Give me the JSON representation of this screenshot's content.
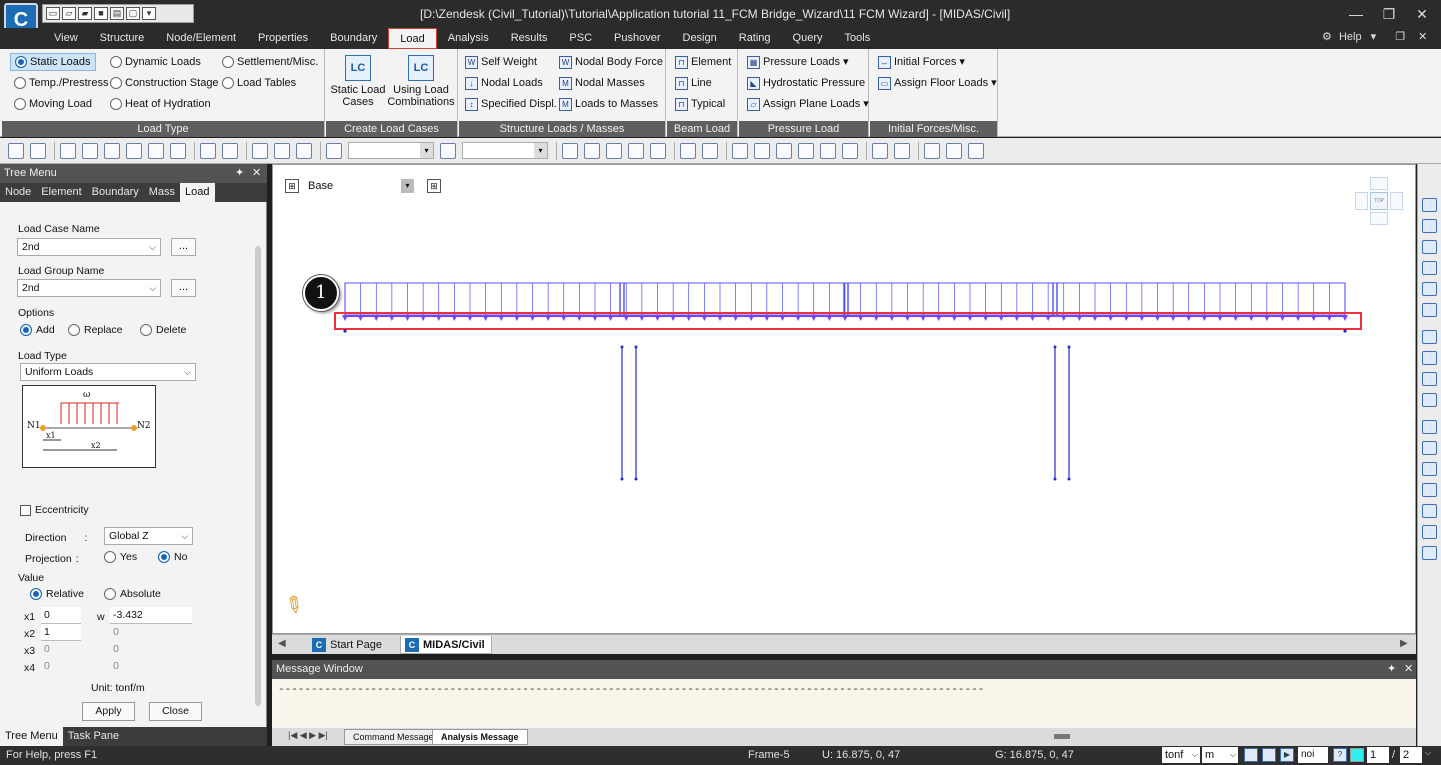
{
  "app": {
    "logo": "C",
    "window_title": "[D:\\Zendesk (Civil_Tutorial)\\Tutorial\\Application tutorial 11_FCM Bridge_Wizard\\11 FCM Wizard] - [MIDAS/Civil]",
    "help_label": "Help"
  },
  "menu_tabs": [
    "View",
    "Structure",
    "Node/Element",
    "Properties",
    "Boundary",
    "Load",
    "Analysis",
    "Results",
    "PSC",
    "Pushover",
    "Design",
    "Rating",
    "Query",
    "Tools"
  ],
  "active_menu_tab": "Load",
  "ribbon": {
    "load_type": {
      "label": "Load Type",
      "items": [
        "Static Loads",
        "Dynamic Loads",
        "Settlement/Misc.",
        "Temp./Prestress",
        "Construction Stage",
        "Load Tables",
        "Moving Load",
        "Heat of Hydration"
      ],
      "selected": "Static Loads"
    },
    "create_load_cases": {
      "label": "Create Load Cases",
      "static_load_cases": "Static Load Cases",
      "static_icon": "LC",
      "using_load_combinations": "Using Load Combinations",
      "combo_icon": "LC"
    },
    "structure_loads": {
      "label": "Structure Loads / Masses",
      "items": [
        "Self Weight",
        "Nodal Body Force",
        "Nodal Loads",
        "Nodal Masses",
        "Specified Displ.",
        "Loads to Masses"
      ]
    },
    "beam_load": {
      "label": "Beam Load",
      "items": [
        "Element",
        "Line",
        "Typical"
      ]
    },
    "pressure_load": {
      "label": "Pressure Load",
      "items": [
        "Pressure Loads",
        "Hydrostatic Pressure",
        "Assign Plane Loads"
      ]
    },
    "initial_forces": {
      "label": "Initial Forces/Misc.",
      "items": [
        "Initial Forces",
        "Assign Floor Loads"
      ]
    }
  },
  "tree_menu": {
    "title": "Tree Menu",
    "tabs": [
      "Node",
      "Element",
      "Boundary",
      "Mass",
      "Load"
    ],
    "active_tab": "Load",
    "load_case_name_label": "Load Case Name",
    "load_case_name_value": "2nd",
    "load_group_name_label": "Load Group Name",
    "load_group_name_value": "2nd",
    "more_button": "...",
    "options_label": "Options",
    "options": [
      "Add",
      "Replace",
      "Delete"
    ],
    "options_selected": "Add",
    "load_type_label": "Load Type",
    "load_type_value": "Uniform Loads",
    "diagram": {
      "w": "ω",
      "n1": "N1",
      "n2": "N2",
      "x1": "x1",
      "x2": "x2"
    },
    "eccentricity_label": "Eccentricity",
    "direction_label": "Direction",
    "direction_colon": ":",
    "direction_value": "Global Z",
    "projection_label": "Projection",
    "projection_colon": ":",
    "projection_options": [
      "Yes",
      "No"
    ],
    "projection_selected": "No",
    "value_label": "Value",
    "value_modes": [
      "Relative",
      "Absolute"
    ],
    "value_mode_selected": "Relative",
    "rows": [
      {
        "x": "x1",
        "xval": "0",
        "w": "w",
        "wval": "-3.432"
      },
      {
        "x": "x2",
        "xval": "1",
        "w": "",
        "wval": "0"
      },
      {
        "x": "x3",
        "xval": "0",
        "w": "",
        "wval": "0"
      },
      {
        "x": "x4",
        "xval": "0",
        "w": "",
        "wval": "0"
      }
    ],
    "unit_label": "Unit:",
    "unit_value": "tonf/m",
    "apply_button": "Apply",
    "close_button": "Close",
    "bottom_tabs": [
      "Tree Menu",
      "Task Pane"
    ]
  },
  "canvas": {
    "view_name": "Base",
    "callout": "1",
    "view_cube_label": "TOP",
    "load_color": "#7f3fff",
    "highlight_color": "#e8333a",
    "member_color": "#2b2bcc"
  },
  "doc_tabs": [
    "Start Page",
    "MIDAS/Civil"
  ],
  "active_doc_tab": "MIDAS/Civil",
  "message_window": {
    "title": "Message Window",
    "content": "-----------------------------------------------------------------------------------------------------------",
    "tabs": [
      "Command Message",
      "Analysis Message"
    ]
  },
  "status": {
    "help_text": "For Help, press F1",
    "frame": "Frame-5",
    "u_coord": "U: 16.875, 0, 47",
    "g_coord": "G: 16.875, 0, 47",
    "force_unit": "tonf",
    "length_unit": "m",
    "option": "noi",
    "page": "1",
    "page_sep": "/",
    "pages": "2"
  }
}
